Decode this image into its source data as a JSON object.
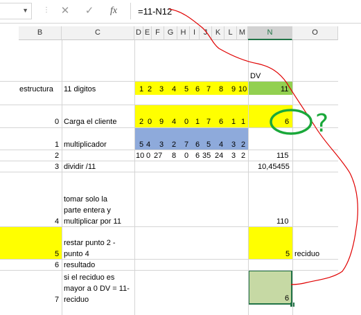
{
  "formula_bar": {
    "name_box": "",
    "cancel_icon": "close-icon",
    "confirm_icon": "check-icon",
    "fx_label": "fx",
    "formula": "=11-N12"
  },
  "columns": [
    "B",
    "C",
    "D",
    "E",
    "F",
    "G",
    "H",
    "I",
    "J",
    "K",
    "L",
    "M",
    "N",
    "O"
  ],
  "header_dv": "DV",
  "row_estructura": {
    "label": "estructura",
    "desc": "11 digitos",
    "digits": [
      "1",
      "2",
      "3",
      "4",
      "5",
      "6",
      "7",
      "8",
      "9",
      "10"
    ],
    "n": "11"
  },
  "row_0": {
    "num": "0",
    "desc": "Carga el cliente",
    "digits": [
      "2",
      "0",
      "9",
      "4",
      "0",
      "1",
      "7",
      "6",
      "1",
      "1"
    ],
    "n": "6"
  },
  "row_1": {
    "num": "1",
    "desc": "multiplicador",
    "digits": [
      "5",
      "4",
      "3",
      "2",
      "7",
      "6",
      "5",
      "4",
      "3",
      "2"
    ]
  },
  "row_2": {
    "num": "2",
    "products": [
      "10",
      "0",
      "27",
      "8",
      "0",
      "6",
      "35",
      "24",
      "3",
      "2"
    ],
    "n": "115"
  },
  "row_3": {
    "num": "3",
    "desc": "dividir /11",
    "n": "10,45455"
  },
  "row_4": {
    "num": "4",
    "desc_lines": [
      "tomar solo la",
      "parte entera y",
      "multiplicar por 11"
    ],
    "n": "110"
  },
  "row_5": {
    "num": "5",
    "desc_lines": [
      "restar punto 2 -",
      "punto 4"
    ],
    "n": "5",
    "o": "reciduo"
  },
  "row_6": {
    "num": "6",
    "desc": "resultado"
  },
  "row_7": {
    "num": "7",
    "desc_lines": [
      "si el reciduo es",
      "mayor a 0 DV = 11-",
      "reciduo"
    ],
    "n": "6"
  },
  "annotation_question": "?",
  "colors": {
    "yellow": "#ffff00",
    "green": "#92d050",
    "blue": "#8eaadb",
    "selected": "#c6d9a4",
    "ink_red": "#e00000",
    "ink_green": "#1aa83a"
  }
}
